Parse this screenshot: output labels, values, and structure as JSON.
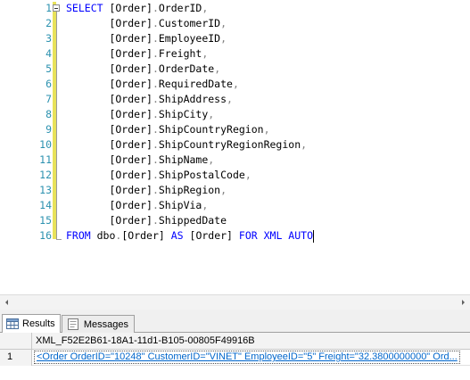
{
  "editor": {
    "line_numbers": [
      "1",
      "2",
      "3",
      "4",
      "5",
      "6",
      "7",
      "8",
      "9",
      "10",
      "11",
      "12",
      "13",
      "14",
      "15",
      "16"
    ],
    "lines": [
      [
        {
          "t": "SELECT ",
          "c": "kw"
        },
        {
          "t": "[Order]",
          "c": "tx"
        },
        {
          "t": ".",
          "c": "gr"
        },
        {
          "t": "OrderID",
          "c": "tx"
        },
        {
          "t": ",",
          "c": "gr"
        }
      ],
      [
        {
          "t": "       [Order]",
          "c": "tx"
        },
        {
          "t": ".",
          "c": "gr"
        },
        {
          "t": "CustomerID",
          "c": "tx"
        },
        {
          "t": ",",
          "c": "gr"
        }
      ],
      [
        {
          "t": "       [Order]",
          "c": "tx"
        },
        {
          "t": ".",
          "c": "gr"
        },
        {
          "t": "EmployeeID",
          "c": "tx"
        },
        {
          "t": ",",
          "c": "gr"
        }
      ],
      [
        {
          "t": "       [Order]",
          "c": "tx"
        },
        {
          "t": ".",
          "c": "gr"
        },
        {
          "t": "Freight",
          "c": "tx"
        },
        {
          "t": ",",
          "c": "gr"
        }
      ],
      [
        {
          "t": "       [Order]",
          "c": "tx"
        },
        {
          "t": ".",
          "c": "gr"
        },
        {
          "t": "OrderDate",
          "c": "tx"
        },
        {
          "t": ",",
          "c": "gr"
        }
      ],
      [
        {
          "t": "       [Order]",
          "c": "tx"
        },
        {
          "t": ".",
          "c": "gr"
        },
        {
          "t": "RequiredDate",
          "c": "tx"
        },
        {
          "t": ",",
          "c": "gr"
        }
      ],
      [
        {
          "t": "       [Order]",
          "c": "tx"
        },
        {
          "t": ".",
          "c": "gr"
        },
        {
          "t": "ShipAddress",
          "c": "tx"
        },
        {
          "t": ",",
          "c": "gr"
        }
      ],
      [
        {
          "t": "       [Order]",
          "c": "tx"
        },
        {
          "t": ".",
          "c": "gr"
        },
        {
          "t": "ShipCity",
          "c": "tx"
        },
        {
          "t": ",",
          "c": "gr"
        }
      ],
      [
        {
          "t": "       [Order]",
          "c": "tx"
        },
        {
          "t": ".",
          "c": "gr"
        },
        {
          "t": "ShipCountryRegion",
          "c": "tx"
        },
        {
          "t": ",",
          "c": "gr"
        }
      ],
      [
        {
          "t": "       [Order]",
          "c": "tx"
        },
        {
          "t": ".",
          "c": "gr"
        },
        {
          "t": "ShipCountryRegionRegion",
          "c": "tx"
        },
        {
          "t": ",",
          "c": "gr"
        }
      ],
      [
        {
          "t": "       [Order]",
          "c": "tx"
        },
        {
          "t": ".",
          "c": "gr"
        },
        {
          "t": "ShipName",
          "c": "tx"
        },
        {
          "t": ",",
          "c": "gr"
        }
      ],
      [
        {
          "t": "       [Order]",
          "c": "tx"
        },
        {
          "t": ".",
          "c": "gr"
        },
        {
          "t": "ShipPostalCode",
          "c": "tx"
        },
        {
          "t": ",",
          "c": "gr"
        }
      ],
      [
        {
          "t": "       [Order]",
          "c": "tx"
        },
        {
          "t": ".",
          "c": "gr"
        },
        {
          "t": "ShipRegion",
          "c": "tx"
        },
        {
          "t": ",",
          "c": "gr"
        }
      ],
      [
        {
          "t": "       [Order]",
          "c": "tx"
        },
        {
          "t": ".",
          "c": "gr"
        },
        {
          "t": "ShipVia",
          "c": "tx"
        },
        {
          "t": ",",
          "c": "gr"
        }
      ],
      [
        {
          "t": "       [Order]",
          "c": "tx"
        },
        {
          "t": ".",
          "c": "gr"
        },
        {
          "t": "ShippedDate",
          "c": "tx"
        }
      ],
      [
        {
          "t": "FROM ",
          "c": "kw"
        },
        {
          "t": "dbo",
          "c": "tx"
        },
        {
          "t": ".",
          "c": "gr"
        },
        {
          "t": "[Order] ",
          "c": "tx"
        },
        {
          "t": "AS ",
          "c": "kw"
        },
        {
          "t": "[Order] ",
          "c": "tx"
        },
        {
          "t": "FOR XML AUTO",
          "c": "kw"
        }
      ]
    ]
  },
  "tabs": {
    "results": "Results",
    "messages": "Messages"
  },
  "grid": {
    "column_header": "XML_F52E2B61-18A1-11d1-B105-00805F49916B",
    "rows": [
      {
        "num": "1",
        "value": "<Order OrderID=\"10248\" CustomerID=\"VINET\" EmployeeID=\"5\" Freight=\"32.3800000000\" Ord..."
      }
    ]
  },
  "colors": {
    "keyword": "#0000ff",
    "line_number": "#2b91af",
    "change_bar": "#e8e25a",
    "link": "#0066cc"
  },
  "icons": [
    "collapse-minus-icon",
    "scroll-left-icon",
    "scroll-right-icon",
    "results-grid-icon",
    "messages-icon"
  ]
}
